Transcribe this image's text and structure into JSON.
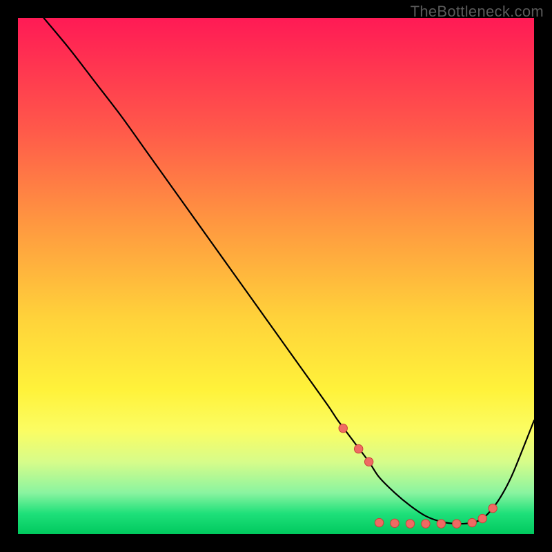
{
  "watermark": "TheBottleneck.com",
  "colors": {
    "page_bg": "#000000",
    "gradient_top": "#ff1a55",
    "gradient_bottom": "#00c95e",
    "curve": "#000000",
    "dot_fill": "#ef6a63",
    "dot_stroke": "#c9423a"
  },
  "chart_data": {
    "type": "line",
    "title": "",
    "xlabel": "",
    "ylabel": "",
    "xlim": [
      0,
      100
    ],
    "ylim": [
      0,
      100
    ],
    "grid": false,
    "legend": false,
    "series": [
      {
        "name": "curve",
        "x": [
          5,
          10,
          15,
          20,
          25,
          30,
          35,
          40,
          45,
          50,
          55,
          60,
          62,
          65,
          68,
          70,
          73,
          76,
          79,
          82,
          85,
          88,
          90,
          92,
          94,
          96,
          100
        ],
        "y": [
          100,
          94,
          87.5,
          81,
          74,
          67,
          60,
          53,
          46,
          39,
          32,
          25,
          22,
          18,
          14,
          11,
          8,
          5.5,
          3.5,
          2.4,
          2.0,
          2.2,
          3.0,
          5.0,
          8.0,
          12.0,
          22.0
        ]
      }
    ],
    "markers": {
      "name": "dots",
      "x": [
        63,
        66,
        68,
        70,
        73,
        76,
        79,
        82,
        85,
        88,
        90,
        92
      ],
      "y": [
        20.5,
        16.5,
        14,
        2.2,
        2.1,
        2.0,
        2.0,
        2.0,
        2.0,
        2.2,
        3.0,
        5.0
      ]
    }
  }
}
